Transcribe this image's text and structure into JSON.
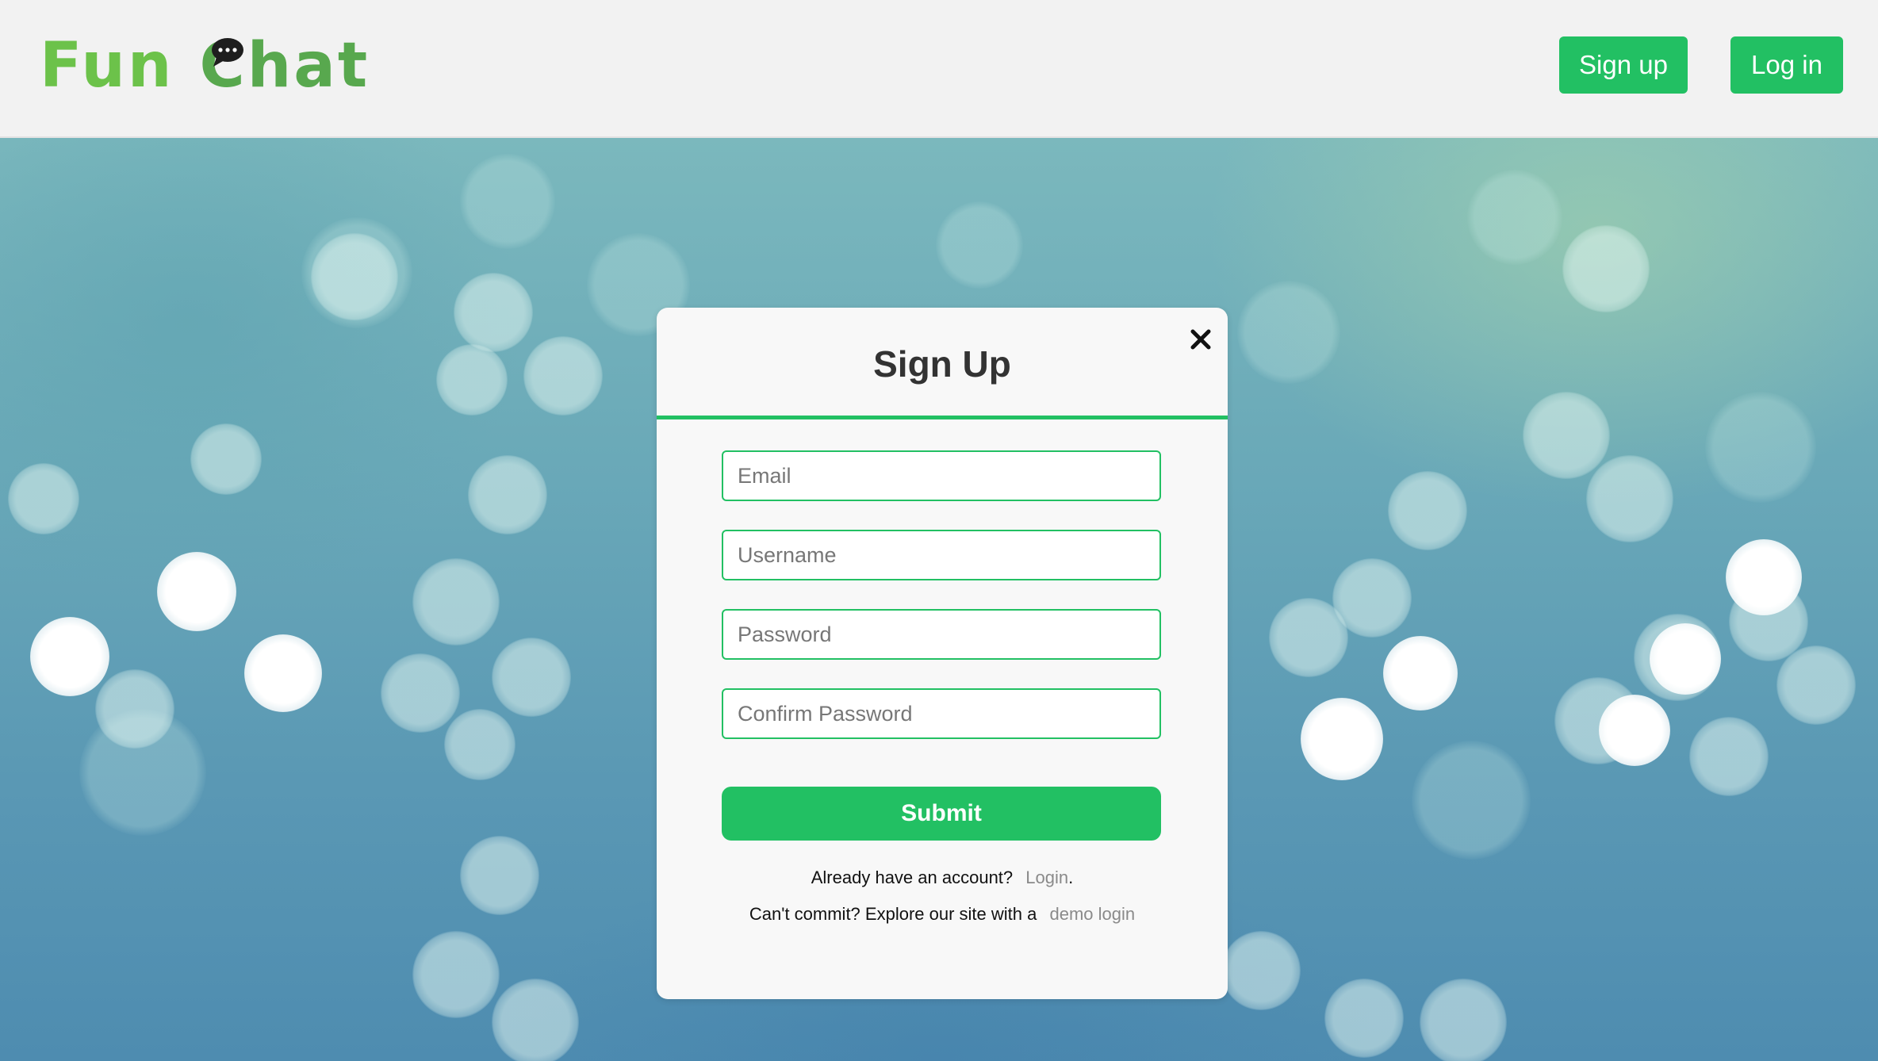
{
  "header": {
    "logo": {
      "word1": "Fun",
      "word2": "Chat",
      "icon": "chat-bubble-icon"
    },
    "signup_label": "Sign up",
    "login_label": "Log in"
  },
  "modal": {
    "title": "Sign Up",
    "close_icon": "close-icon",
    "fields": {
      "email_placeholder": "Email",
      "username_placeholder": "Username",
      "password_placeholder": "Password",
      "confirm_placeholder": "Confirm Password"
    },
    "submit_label": "Submit",
    "already_text": "Already have an account?",
    "login_link": "Login",
    "already_period": ".",
    "demo_text": "Can't commit? Explore our site with a",
    "demo_link": "demo login"
  },
  "colors": {
    "accent": "#22c063",
    "logo_green": "#65b85a",
    "header_bg": "#f2f2f2",
    "modal_bg": "#f8f8f8"
  }
}
